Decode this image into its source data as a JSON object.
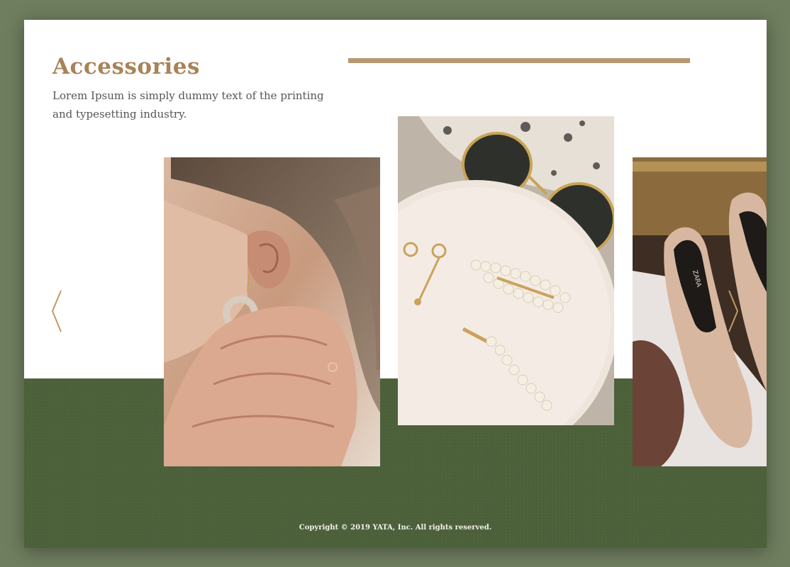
{
  "section": {
    "title": "Accessories",
    "description": "Lorem Ipsum is simply dummy text of the printing and typesetting industry."
  },
  "gallery": {
    "items": [
      {
        "subject": "woman putting on earring"
      },
      {
        "subject": "sunglasses, earrings and pearl hair clips on a plate"
      },
      {
        "subject": "nude pumps on magazines",
        "visible_text": "ZARA"
      }
    ],
    "prev_icon": "chevron-left-icon",
    "next_icon": "chevron-right-icon"
  },
  "footer": {
    "copyright": "Copyright © 2019 YATA, Inc. All rights reserved."
  },
  "colors": {
    "background": "#6f7e5f",
    "page": "#ffffff",
    "accent": "#a88358",
    "footer_band": "#4b5f39",
    "text": "#555555",
    "footer_text": "#f2f2ea"
  }
}
